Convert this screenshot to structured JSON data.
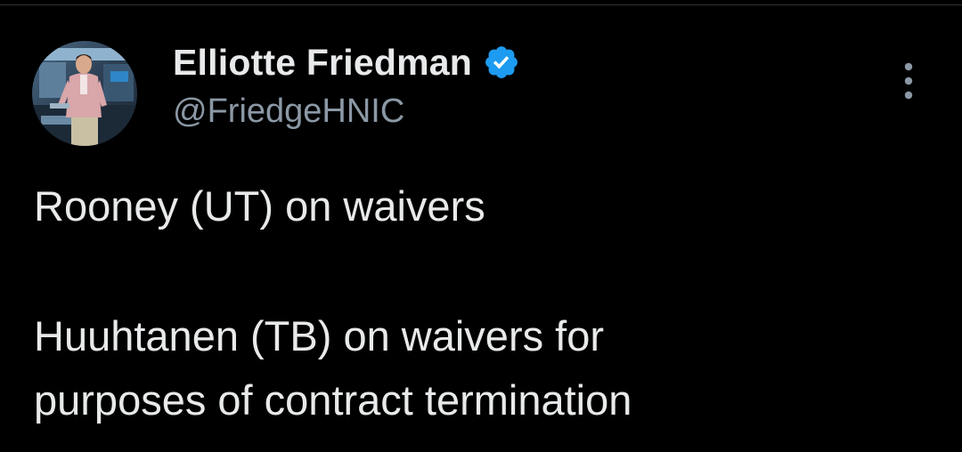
{
  "colors": {
    "background": "#000000",
    "text_primary": "#e7e9ea",
    "text_secondary": "#8b98a5",
    "verified_badge": "#1d9bf0"
  },
  "author": {
    "display_name": "Elliotte Friedman",
    "handle": "@FriedgeHNIC",
    "verified": true,
    "verified_icon": "verified-badge-icon",
    "avatar_icon": "profile-photo"
  },
  "menu": {
    "more_icon": "more-vertical-icon"
  },
  "tweet": {
    "lines": [
      "Rooney (UT) on waivers",
      "Huuhtanen (TB) on waivers for",
      "purposes of contract termination"
    ]
  }
}
